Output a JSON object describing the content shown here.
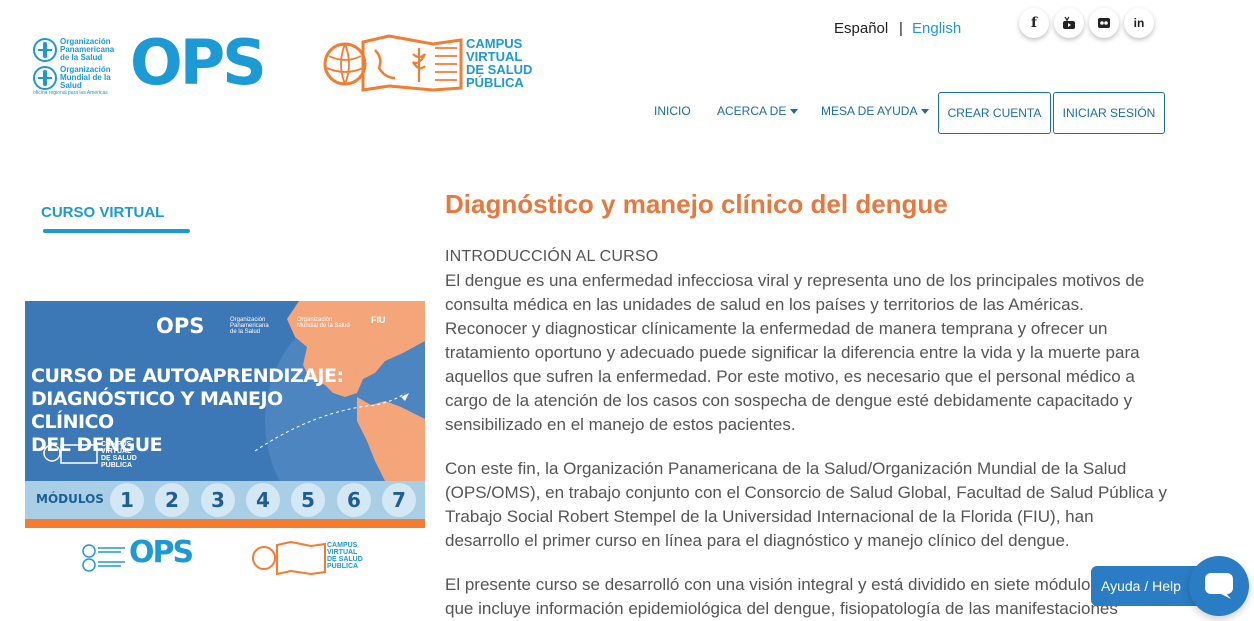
{
  "header": {
    "logo": {
      "who_lines": [
        "Organización Panamericana de la Salud",
        "Organización Mundial de la Salud"
      ],
      "who_subline": "oficina regional para las Américas",
      "ops_word": "OPS",
      "campus_lines": [
        "CAMPUS",
        "VIRTUAL",
        "DE SALUD",
        "PÚBLICA"
      ]
    },
    "languages": {
      "es": "Español",
      "separator": "|",
      "en": "English"
    },
    "social": [
      {
        "icon": "facebook-icon",
        "glyph": "f"
      },
      {
        "icon": "youtube-icon",
        "glyph": "▶"
      },
      {
        "icon": "flickr-icon",
        "glyph": "●●"
      },
      {
        "icon": "linkedin-icon",
        "glyph": "in"
      }
    ],
    "nav": {
      "inicio": "INICIO",
      "acerca": "ACERCA DE",
      "mesa": "MESA DE AYUDA",
      "crear": "CREAR CUENTA",
      "iniciar": "INICIAR SESIÓN"
    }
  },
  "sidebar": {
    "label": "CURSO VIRTUAL",
    "banner": {
      "ops": "OPS",
      "org1": [
        "Organización",
        "Panamericana",
        "de la Salud"
      ],
      "org2": [
        "Organización",
        "Mundial de la Salud"
      ],
      "fiu": "FIU",
      "title_lines": [
        "CURSO DE AUTOAPRENDIZAJE:",
        "DIAGNÓSTICO Y MANEJO CLÍNICO",
        "DEL DENGUE"
      ],
      "campus_lines": [
        "CAMPUS",
        "VIRTUAL",
        "DE SALUD",
        "PÚBLICA"
      ],
      "modules_label": "MÓDULOS",
      "modules": [
        "1",
        "2",
        "3",
        "4",
        "5",
        "6",
        "7"
      ],
      "footer_ops": "OPS",
      "footer_campus_lines": [
        "CAMPUS",
        "VIRTUAL",
        "DE SALUD",
        "PÚBLICA"
      ]
    }
  },
  "main": {
    "title": "Diagnóstico y manejo clínico del dengue",
    "section_heading": "INTRODUCCIÓN AL CURSO",
    "paragraphs": [
      "El dengue es una enfermedad infecciosa viral y representa uno de los principales motivos de consulta médica en las unidades de salud en los países y territorios de las Américas. Reconocer y diagnosticar clínicamente la enfermedad de manera temprana y ofrecer un tratamiento oportuno y adecuado puede significar la diferencia entre la vida y la muerte para aquellos que sufren la enfermedad. Por este motivo, es necesario que el personal médico a cargo de la atención de los casos con sospecha de dengue esté debidamente capacitado y sensibilizado en el manejo de estos pacientes.",
      "Con este fin, la Organización Panamericana de la Salud/Organización Mundial de la Salud (OPS/OMS), en trabajo conjunto con el Consorcio de Salud Global, Facultad de Salud Pública y Trabajo Social Robert Stempel de la Universidad Internacional de la Florida (FIU), han desarrollo el primer curso en línea para el diagnóstico y manejo clínico del dengue.",
      "El presente curso se desarrolló con una visión integral y está dividido en siete módulos que incluye información epidemiológica del dengue, fisiopatología de las manifestaciones"
    ]
  },
  "help": {
    "label": "Ayuda / Help",
    "icon": "chat-bubble-icon"
  },
  "colors": {
    "brand_blue": "#1c9ad6",
    "nav_blue": "#1a6eaa",
    "title_orange": "#e8783c",
    "help_blue": "#2a7dc4"
  }
}
